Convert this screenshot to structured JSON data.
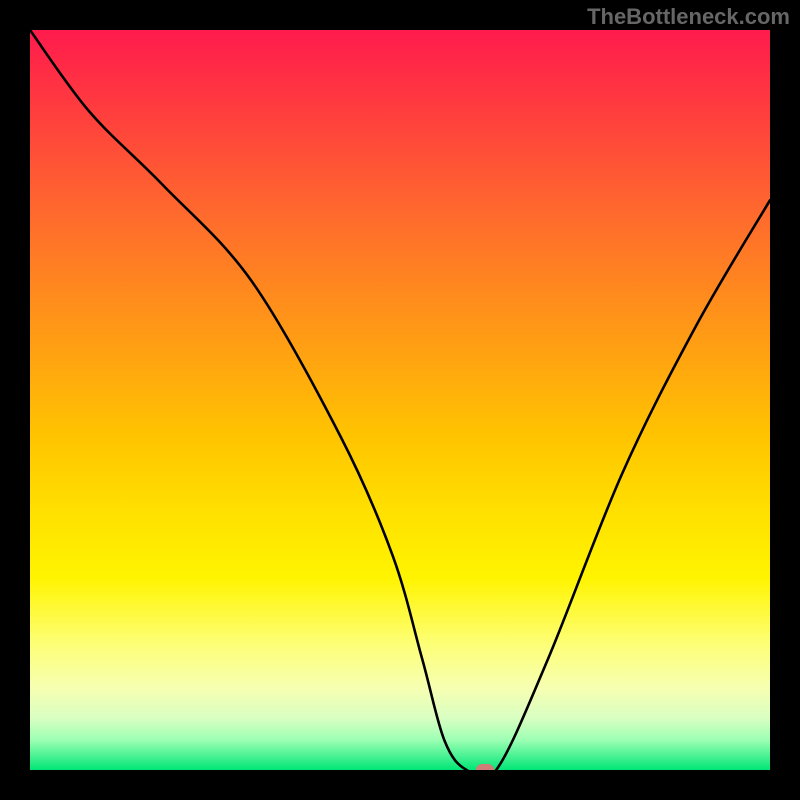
{
  "watermark": "TheBottleneck.com",
  "chart_data": {
    "type": "line",
    "title": "",
    "xlabel": "",
    "ylabel": "",
    "xlim": [
      0,
      100
    ],
    "ylim": [
      0,
      100
    ],
    "grid": false,
    "series": [
      {
        "name": "bottleneck-curve",
        "x": [
          0,
          8,
          18,
          30,
          42,
          49,
          53,
          56,
          59,
          63,
          70,
          80,
          90,
          100
        ],
        "y": [
          100,
          89,
          79,
          66,
          45,
          29,
          15,
          4,
          0,
          0,
          15,
          40,
          60,
          77
        ]
      }
    ],
    "marker": {
      "x": 61.5,
      "y": 0
    },
    "background": {
      "type": "vertical-gradient",
      "stops": [
        {
          "pos": 0,
          "color": "#ff1b4d"
        },
        {
          "pos": 10,
          "color": "#ff3a3f"
        },
        {
          "pos": 25,
          "color": "#ff6a2d"
        },
        {
          "pos": 40,
          "color": "#ff9717"
        },
        {
          "pos": 55,
          "color": "#ffc400"
        },
        {
          "pos": 65,
          "color": "#ffe000"
        },
        {
          "pos": 74,
          "color": "#fff400"
        },
        {
          "pos": 83,
          "color": "#fdff77"
        },
        {
          "pos": 89,
          "color": "#f6ffb2"
        },
        {
          "pos": 93,
          "color": "#d8ffc2"
        },
        {
          "pos": 96,
          "color": "#9bffb3"
        },
        {
          "pos": 100,
          "color": "#00e676"
        }
      ]
    }
  }
}
